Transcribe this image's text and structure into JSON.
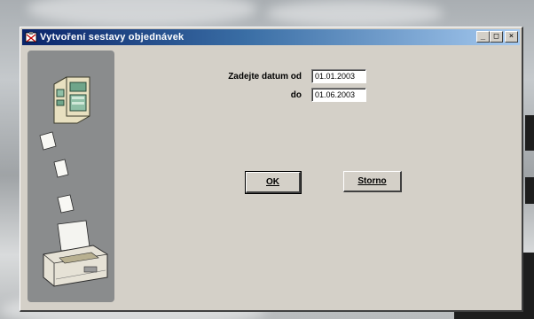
{
  "window": {
    "title": "Vytvoření sestavy objednávek",
    "min_label": "_",
    "max_label": "□",
    "close_label": "×"
  },
  "form": {
    "date_from_label": "Zadejte datum od",
    "date_from_value": "01.01.2003",
    "date_to_label": "do",
    "date_to_value": "01.06.2003"
  },
  "buttons": {
    "ok_label": "OK",
    "cancel_label": "Storno"
  },
  "icons": {
    "app": "form-icon",
    "side": "fax-printer-illustration"
  },
  "colors": {
    "titlebar_start": "#0a246a",
    "titlebar_end": "#a6caf0",
    "window_bg": "#d4d0c8",
    "side_panel": "#8a8c8d"
  }
}
